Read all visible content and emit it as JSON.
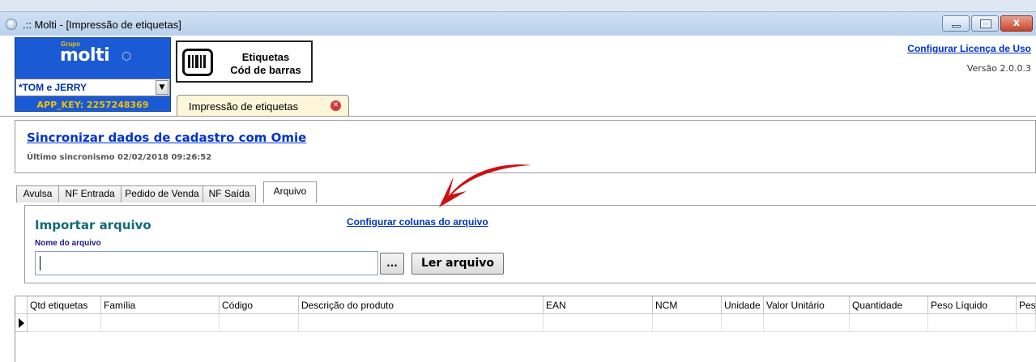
{
  "window": {
    "title": ".:: Molti - [Impressão de etiquetas]",
    "close_glyph": "x"
  },
  "brand": {
    "group_label": "Grupo",
    "logo_text": "molti",
    "company_selected": "*TOM e JERRY",
    "app_key": "APP_KEY: 2257248369"
  },
  "product": {
    "line1": "Etiquetas",
    "line2": "Cód de barras"
  },
  "doc_tab": {
    "label": "Impressão de etiquetas"
  },
  "header_right": {
    "license_link": "Configurar Licença de Uso",
    "version": "Versão 2.0.0.3"
  },
  "sync": {
    "link": "Sincronizar dados de cadastro com Omie",
    "last_sync": "Último sincronismo 02/02/2018 09:26:52"
  },
  "tabs": [
    {
      "label": "Avulsa",
      "active": false
    },
    {
      "label": "NF Entrada",
      "active": false
    },
    {
      "label": "Pedido de Venda",
      "active": false
    },
    {
      "label": "NF Saída",
      "active": false
    },
    {
      "label": "Arquivo",
      "active": true
    }
  ],
  "import": {
    "heading": "Importar arquivo",
    "configure_link": "Configurar colunas do arquivo",
    "file_label": "Nome do arquivo",
    "file_value": "",
    "browse_label": "...",
    "read_button": "Ler arquivo"
  },
  "grid": {
    "columns": [
      "Qtd etiquetas",
      "Família",
      "Código",
      "Descrição do produto",
      "EAN",
      "NCM",
      "Unidade",
      "Valor Unitário",
      "Quantidade",
      "Peso Líquido",
      "Pes"
    ]
  },
  "colors": {
    "brand_blue": "#1a5ad4",
    "brand_yellow": "#f2c200",
    "link_blue": "#0033cc",
    "heading_teal": "#0f6b78",
    "annotation_red": "#cc1111"
  }
}
